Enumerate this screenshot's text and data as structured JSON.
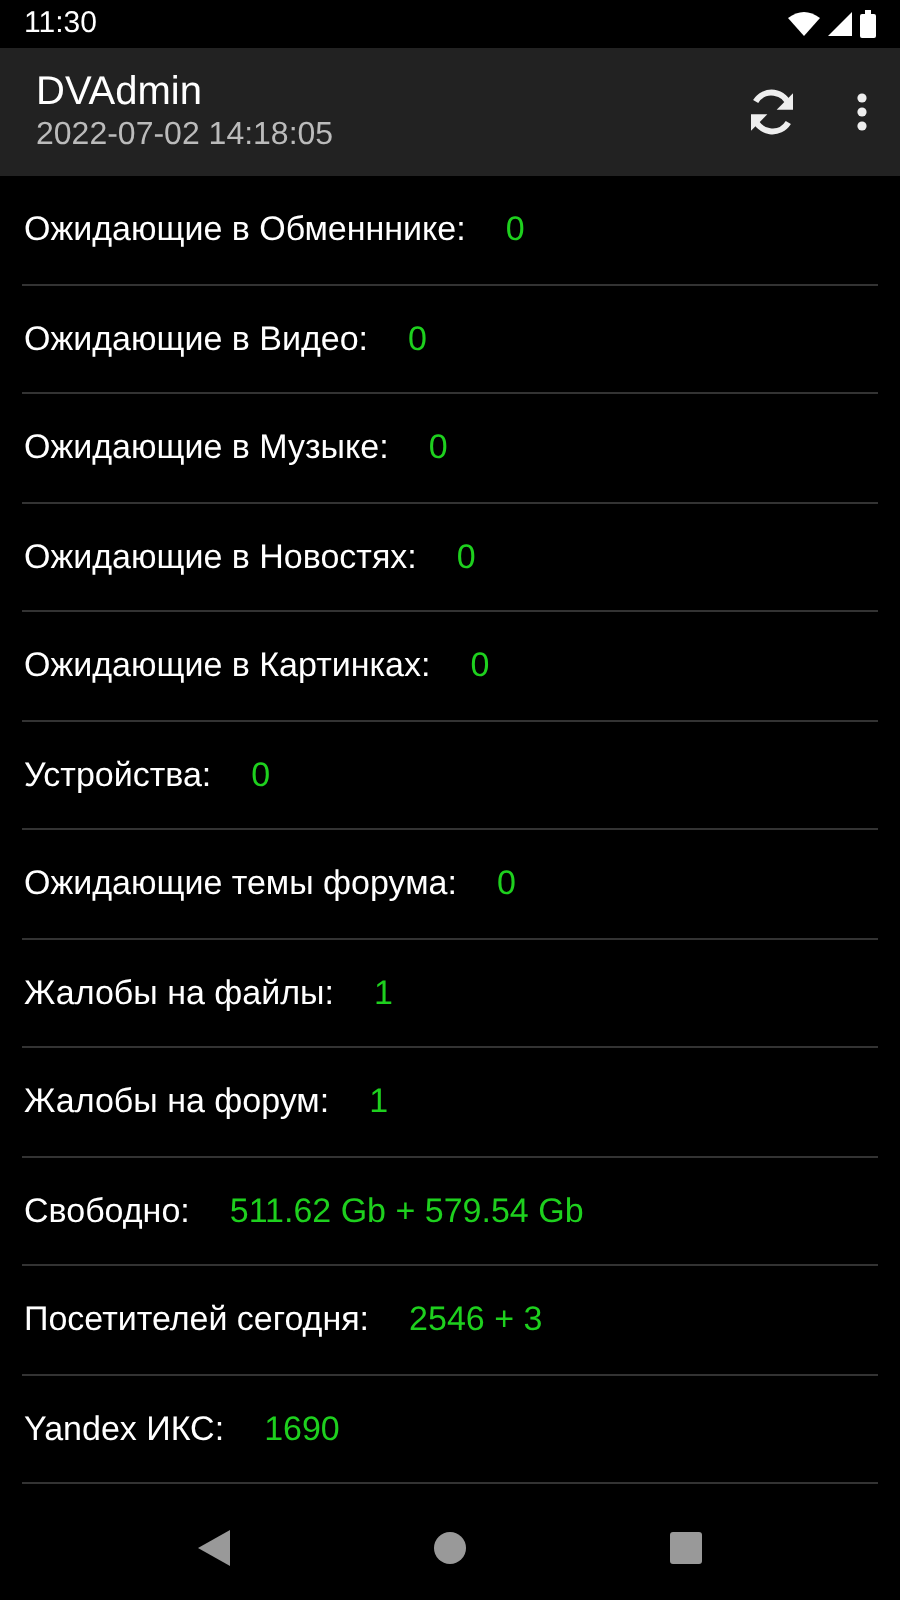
{
  "status_bar": {
    "time": "11:30"
  },
  "app_bar": {
    "title": "DVAdmin",
    "subtitle": "2022-07-02 14:18:05"
  },
  "stats": [
    {
      "label": "Ожидающие в Обменннике:",
      "value": "0"
    },
    {
      "label": "Ожидающие в Видео:",
      "value": "0"
    },
    {
      "label": "Ожидающие в Музыке:",
      "value": "0"
    },
    {
      "label": "Ожидающие в Новостях:",
      "value": "0"
    },
    {
      "label": "Ожидающие в Картинках:",
      "value": "0"
    },
    {
      "label": "Устройства:",
      "value": "0"
    },
    {
      "label": "Ожидающие темы форума:",
      "value": "0"
    },
    {
      "label": "Жалобы на файлы:",
      "value": "1"
    },
    {
      "label": "Жалобы на форум:",
      "value": "1"
    },
    {
      "label": "Свободно:",
      "value": "511.62 Gb + 579.54 Gb"
    },
    {
      "label": "Посетителей сегодня:",
      "value": "2546 + 3"
    },
    {
      "label": "Yandex ИКС:",
      "value": "1690"
    }
  ]
}
